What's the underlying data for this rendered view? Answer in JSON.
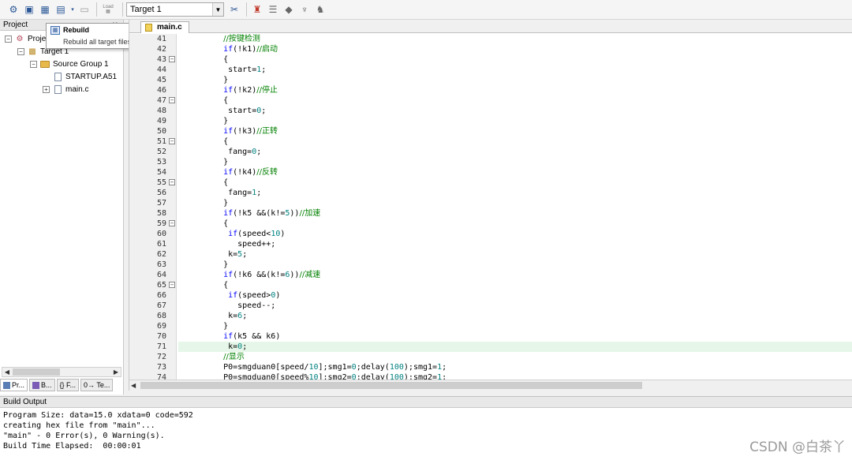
{
  "toolbar": {
    "load_label": "Load",
    "target_value": "Target 1"
  },
  "project_panel": {
    "title": "Project",
    "tree": [
      {
        "label": "Proje",
        "level": 0,
        "toggle": "−"
      },
      {
        "label": "Target 1",
        "level": 1,
        "toggle": "−"
      },
      {
        "label": "Source Group 1",
        "level": 2,
        "toggle": "−"
      },
      {
        "label": "STARTUP.A51",
        "level": 3,
        "toggle": ""
      },
      {
        "label": "main.c",
        "level": 3,
        "toggle": "+"
      }
    ],
    "tabs": [
      "Pr...",
      "B...",
      "{} F...",
      "0→ Te..."
    ]
  },
  "tooltip": {
    "title": "Rebuild",
    "description": "Rebuild all target files"
  },
  "editor": {
    "tab_label": "main.c",
    "highlight_line": 71,
    "lines": [
      {
        "n": 41,
        "fold": "",
        "parts": [
          [
            "    ",
            ""
          ],
          [
            "//按键检测",
            "cm"
          ]
        ]
      },
      {
        "n": 42,
        "fold": "",
        "parts": [
          [
            "    ",
            ""
          ],
          [
            "if",
            "kw"
          ],
          [
            "(!k1)",
            ""
          ],
          [
            "//启动",
            "cm"
          ]
        ]
      },
      {
        "n": 43,
        "fold": "−",
        "parts": [
          [
            "    {",
            ""
          ]
        ]
      },
      {
        "n": 44,
        "fold": "",
        "parts": [
          [
            "     start=",
            ""
          ],
          [
            "1",
            "num"
          ],
          [
            ";",
            ""
          ]
        ]
      },
      {
        "n": 45,
        "fold": "",
        "parts": [
          [
            "    }",
            ""
          ]
        ]
      },
      {
        "n": 46,
        "fold": "",
        "parts": [
          [
            "    ",
            ""
          ],
          [
            "if",
            "kw"
          ],
          [
            "(!k2)",
            ""
          ],
          [
            "//停止",
            "cm"
          ]
        ]
      },
      {
        "n": 47,
        "fold": "−",
        "parts": [
          [
            "    {",
            ""
          ]
        ]
      },
      {
        "n": 48,
        "fold": "",
        "parts": [
          [
            "     start=",
            ""
          ],
          [
            "0",
            "num"
          ],
          [
            ";",
            ""
          ]
        ]
      },
      {
        "n": 49,
        "fold": "",
        "parts": [
          [
            "    }",
            ""
          ]
        ]
      },
      {
        "n": 50,
        "fold": "",
        "parts": [
          [
            "    ",
            ""
          ],
          [
            "if",
            "kw"
          ],
          [
            "(!k3)",
            ""
          ],
          [
            "//正转",
            "cm"
          ]
        ]
      },
      {
        "n": 51,
        "fold": "−",
        "parts": [
          [
            "    {",
            ""
          ]
        ]
      },
      {
        "n": 52,
        "fold": "",
        "parts": [
          [
            "     fang=",
            ""
          ],
          [
            "0",
            "num"
          ],
          [
            ";",
            ""
          ]
        ]
      },
      {
        "n": 53,
        "fold": "",
        "parts": [
          [
            "    }",
            ""
          ]
        ]
      },
      {
        "n": 54,
        "fold": "",
        "parts": [
          [
            "    ",
            ""
          ],
          [
            "if",
            "kw"
          ],
          [
            "(!k4)",
            ""
          ],
          [
            "//反转",
            "cm"
          ]
        ]
      },
      {
        "n": 55,
        "fold": "−",
        "parts": [
          [
            "    {",
            ""
          ]
        ]
      },
      {
        "n": 56,
        "fold": "",
        "parts": [
          [
            "     fang=",
            ""
          ],
          [
            "1",
            "num"
          ],
          [
            ";",
            ""
          ]
        ]
      },
      {
        "n": 57,
        "fold": "",
        "parts": [
          [
            "    }",
            ""
          ]
        ]
      },
      {
        "n": 58,
        "fold": "",
        "parts": [
          [
            "    ",
            ""
          ],
          [
            "if",
            "kw"
          ],
          [
            "(!k5 &&(k!=",
            ""
          ],
          [
            "5",
            "num"
          ],
          [
            "))",
            ""
          ],
          [
            "//加速",
            "cm"
          ]
        ]
      },
      {
        "n": 59,
        "fold": "−",
        "parts": [
          [
            "    {",
            ""
          ]
        ]
      },
      {
        "n": 60,
        "fold": "",
        "parts": [
          [
            "     ",
            ""
          ],
          [
            "if",
            "kw"
          ],
          [
            "(speed<",
            ""
          ],
          [
            "10",
            "num"
          ],
          [
            ")",
            ""
          ]
        ]
      },
      {
        "n": 61,
        "fold": "",
        "parts": [
          [
            "       speed++;",
            ""
          ]
        ]
      },
      {
        "n": 62,
        "fold": "",
        "parts": [
          [
            "     k=",
            ""
          ],
          [
            "5",
            "num"
          ],
          [
            ";",
            ""
          ]
        ]
      },
      {
        "n": 63,
        "fold": "",
        "parts": [
          [
            "    }",
            ""
          ]
        ]
      },
      {
        "n": 64,
        "fold": "",
        "parts": [
          [
            "    ",
            ""
          ],
          [
            "if",
            "kw"
          ],
          [
            "(!k6 &&(k!=",
            ""
          ],
          [
            "6",
            "num"
          ],
          [
            "))",
            ""
          ],
          [
            "//减速",
            "cm"
          ]
        ]
      },
      {
        "n": 65,
        "fold": "−",
        "parts": [
          [
            "    {",
            ""
          ]
        ]
      },
      {
        "n": 66,
        "fold": "",
        "parts": [
          [
            "     ",
            ""
          ],
          [
            "if",
            "kw"
          ],
          [
            "(speed>",
            ""
          ],
          [
            "0",
            "num"
          ],
          [
            ")",
            ""
          ]
        ]
      },
      {
        "n": 67,
        "fold": "",
        "parts": [
          [
            "       speed--;",
            ""
          ]
        ]
      },
      {
        "n": 68,
        "fold": "",
        "parts": [
          [
            "     k=",
            ""
          ],
          [
            "6",
            "num"
          ],
          [
            ";",
            ""
          ]
        ]
      },
      {
        "n": 69,
        "fold": "",
        "parts": [
          [
            "    }",
            ""
          ]
        ]
      },
      {
        "n": 70,
        "fold": "",
        "parts": [
          [
            "    ",
            ""
          ],
          [
            "if",
            "kw"
          ],
          [
            "(k5 && k6)",
            ""
          ]
        ]
      },
      {
        "n": 71,
        "fold": "",
        "parts": [
          [
            "     k=",
            ""
          ],
          [
            "0",
            "num"
          ],
          [
            ";",
            ""
          ]
        ]
      },
      {
        "n": 72,
        "fold": "",
        "parts": [
          [
            "    ",
            ""
          ],
          [
            "//显示",
            "cm"
          ]
        ]
      },
      {
        "n": 73,
        "fold": "",
        "parts": [
          [
            "    P0=smgduan0[speed/",
            ""
          ],
          [
            "10",
            "num"
          ],
          [
            "];smg1=",
            ""
          ],
          [
            "0",
            "num"
          ],
          [
            ";delay(",
            ""
          ],
          [
            "100",
            "num"
          ],
          [
            ");smg1=",
            ""
          ],
          [
            "1",
            "num"
          ],
          [
            ";",
            ""
          ]
        ]
      },
      {
        "n": 74,
        "fold": "",
        "parts": [
          [
            "    P0=smgduan0[speed%",
            ""
          ],
          [
            "10",
            "num"
          ],
          [
            "];smg2=",
            ""
          ],
          [
            "0",
            "num"
          ],
          [
            ";delay(",
            ""
          ],
          [
            "100",
            "num"
          ],
          [
            ");smg2=",
            ""
          ],
          [
            "1",
            "num"
          ],
          [
            ";",
            ""
          ]
        ]
      }
    ]
  },
  "build_output": {
    "title": "Build Output",
    "lines": [
      "Program Size: data=15.0 xdata=0 code=592",
      "creating hex file from \"main\"...",
      "\"main\" - 0 Error(s), 0 Warning(s).",
      "Build Time Elapsed:  00:00:01"
    ]
  },
  "watermark": "CSDN @白茶丫",
  "colors": {
    "keyword": "#0000ff",
    "comment": "#008000",
    "number": "#008080",
    "current_line": "#e6f7e9"
  }
}
